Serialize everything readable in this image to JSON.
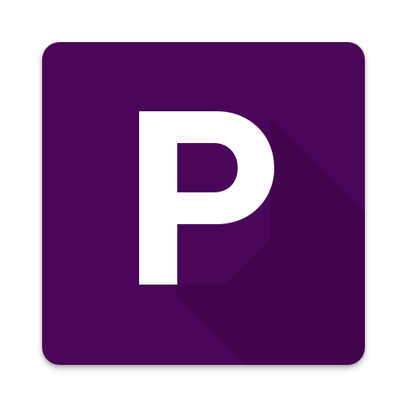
{
  "icon": {
    "glyph": "P",
    "background_color": "#4a0658",
    "long_shadow_color": "#3a0446",
    "glyph_color": "#ffffff"
  }
}
